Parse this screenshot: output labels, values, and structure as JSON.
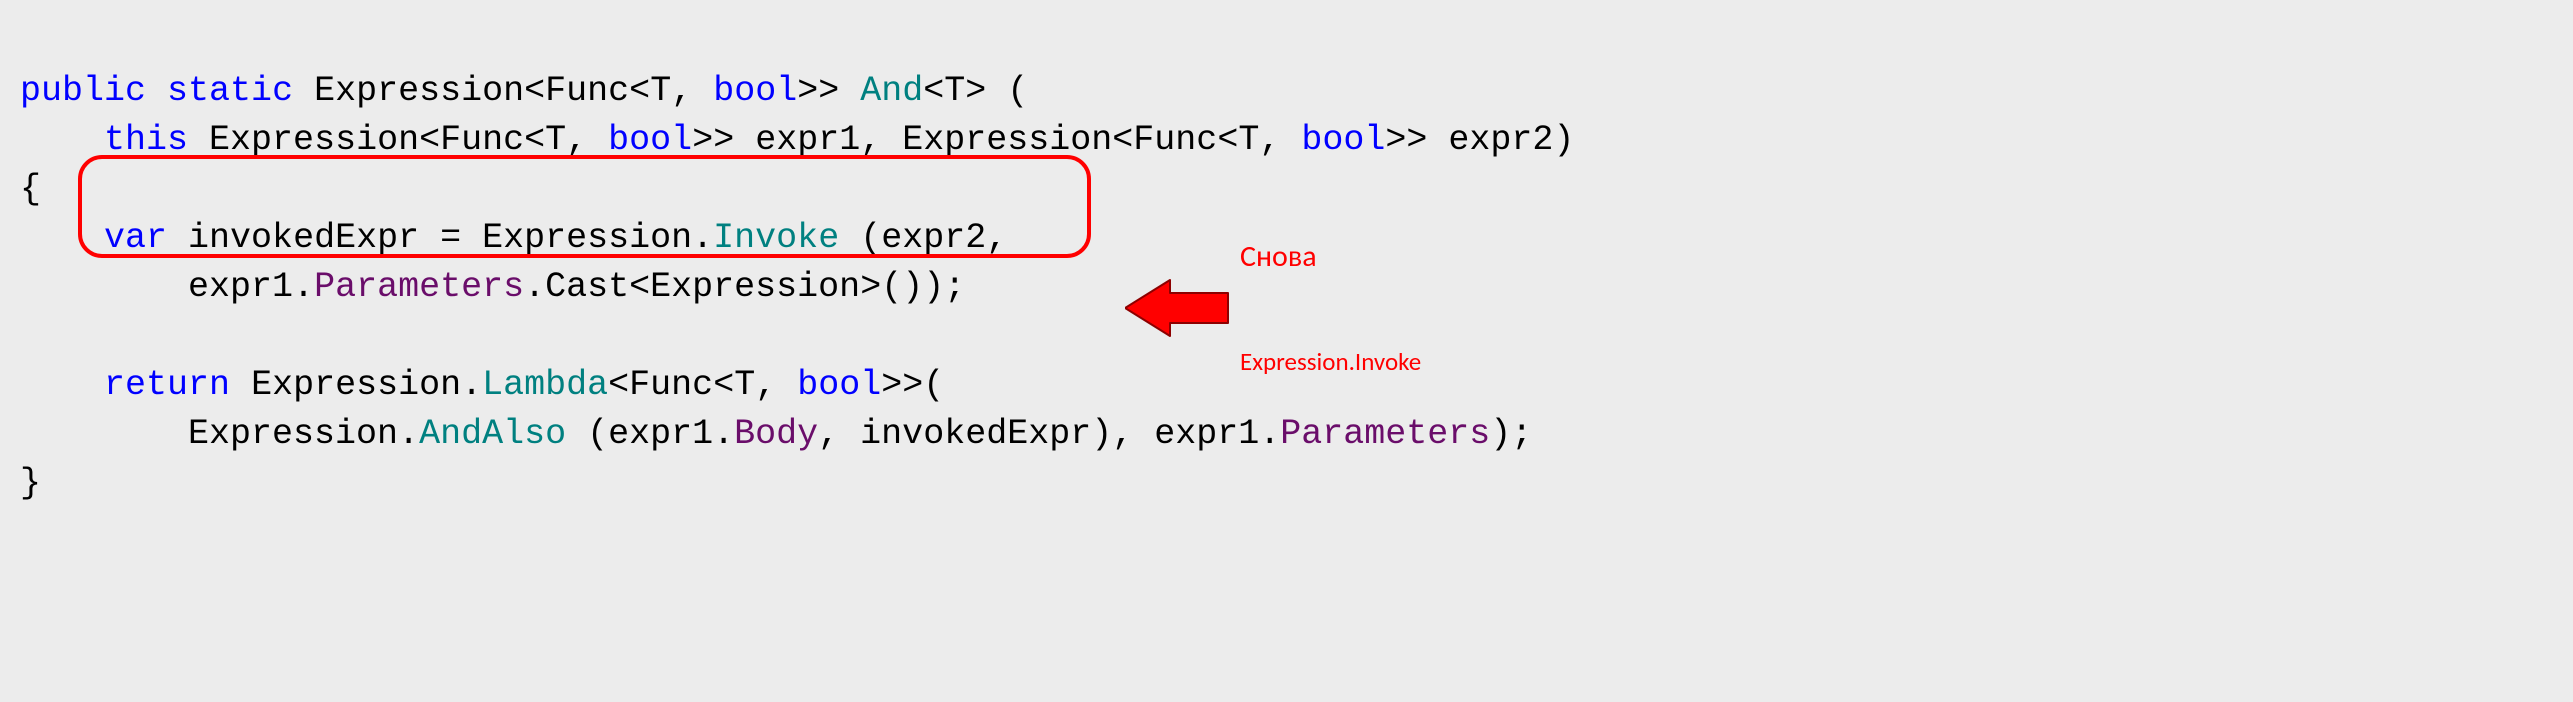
{
  "code": {
    "l1": {
      "kw1": "public",
      "kw2": "static",
      "type1": "Expression",
      "lt1": "<",
      "type2": "Func",
      "lt2": "<",
      "type3": "T",
      "comma1": ", ",
      "kw3": "bool",
      "gt1": ">> ",
      "method1": "And",
      "lt3": "<",
      "type4": "T",
      "gt2": "> ("
    },
    "l2": {
      "indent": "    ",
      "kw1": "this",
      "sp1": " ",
      "type1": "Expression",
      "lt1": "<",
      "type2": "Func",
      "lt2": "<",
      "type3": "T",
      "comma1": ", ",
      "kw2": "bool",
      "gt1": ">> ",
      "id1": "expr1, ",
      "type4": "Expression",
      "lt3": "<",
      "type5": "Func",
      "lt4": "<",
      "type6": "T",
      "comma2": ", ",
      "kw3": "bool",
      "gt2": ">> ",
      "id2": "expr2)"
    },
    "l3": {
      "brace": "{"
    },
    "l4": {
      "indent": "    ",
      "kw1": "var",
      "sp1": " ",
      "id1": "invokedExpr = ",
      "type1": "Expression",
      "dot1": ".",
      "method1": "Invoke",
      "rest": " (expr2,"
    },
    "l5": {
      "indent": "        ",
      "id1": "expr1.",
      "prop1": "Parameters",
      "dot1": ".",
      "id2": "Cast<",
      "type1": "Expression",
      "rest": ">());"
    },
    "l6": {
      "empty": ""
    },
    "l7": {
      "indent": "    ",
      "kw1": "return",
      "sp1": " ",
      "type1": "Expression",
      "dot1": ".",
      "method1": "Lambda",
      "lt1": "<",
      "type2": "Func",
      "lt2": "<",
      "type3": "T",
      "comma1": ", ",
      "kw2": "bool",
      "gt1": ">>("
    },
    "l8": {
      "indent": "        ",
      "type1": "Expression",
      "dot1": ".",
      "method1": "AndAlso",
      "rest1": " (expr1.",
      "prop1": "Body",
      "rest2": ", invokedExpr), expr1.",
      "prop2": "Parameters",
      "rest3": ");"
    },
    "l9": {
      "brace": "}"
    }
  },
  "annotation": {
    "line1": "Снова",
    "line2": "Expression.Invoke"
  }
}
